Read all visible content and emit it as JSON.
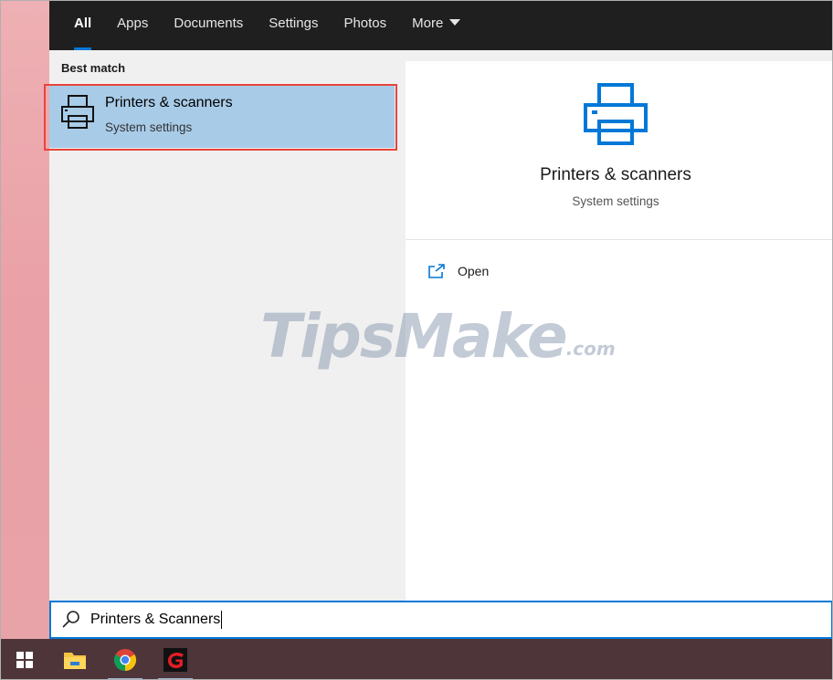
{
  "tabs": [
    {
      "label": "All"
    },
    {
      "label": "Apps"
    },
    {
      "label": "Documents"
    },
    {
      "label": "Settings"
    },
    {
      "label": "Photos"
    },
    {
      "label": "More"
    }
  ],
  "results": {
    "section_label": "Best match",
    "best_match": {
      "title": "Printers & scanners",
      "subtitle": "System settings",
      "icon": "printer-icon"
    }
  },
  "preview": {
    "title": "Printers & scanners",
    "subtitle": "System settings",
    "icon": "printer-icon",
    "actions": [
      {
        "label": "Open",
        "icon": "open-external-icon"
      }
    ]
  },
  "watermark": {
    "text": "TipsMake",
    "suffix": ".com"
  },
  "search": {
    "value": "Printers & Scanners",
    "icon": "search-icon"
  },
  "taskbar": {
    "items": [
      {
        "icon": "windows-start-icon"
      },
      {
        "icon": "file-explorer-icon"
      },
      {
        "icon": "chrome-icon"
      },
      {
        "icon": "garena-icon"
      }
    ]
  },
  "colors": {
    "accent": "#0078d7",
    "selection": "#a8cbe8",
    "highlight_border": "#e8453c",
    "tab_bar": "#1f1f1f",
    "taskbar": "#4d3539"
  }
}
